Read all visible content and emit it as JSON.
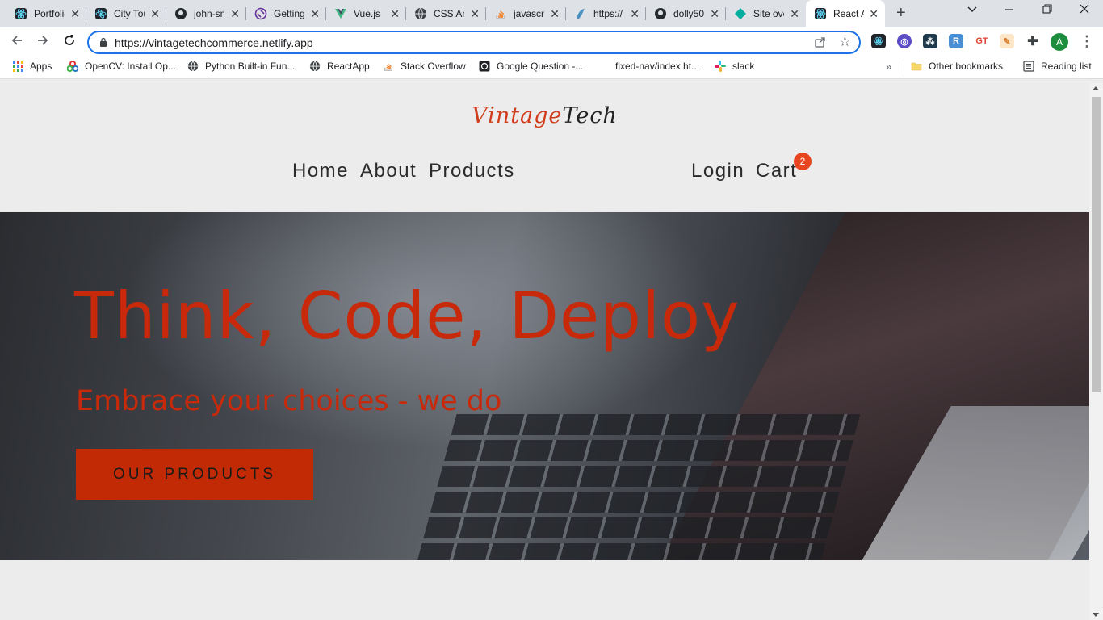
{
  "browser": {
    "tabs": [
      {
        "title": "Portfolio",
        "icon": "react-icon",
        "color": "#61dafb"
      },
      {
        "title": "City Tours",
        "icon": "react-icon",
        "color": "#61dafb"
      },
      {
        "title": "john-smilga",
        "icon": "github-icon",
        "color": "#24292e"
      },
      {
        "title": "Getting Started",
        "icon": "gatsby-icon",
        "color": "#663399"
      },
      {
        "title": "Vue.js",
        "icon": "vue-icon",
        "color": "#41b883"
      },
      {
        "title": "CSS Animations",
        "icon": "globe-icon",
        "color": "#202124"
      },
      {
        "title": "javascript",
        "icon": "stackoverflow-icon",
        "color": "#f48024"
      },
      {
        "title": "https://",
        "icon": "doc-icon",
        "color": "#4a90c2"
      },
      {
        "title": "dolly50",
        "icon": "github-icon",
        "color": "#24292e"
      },
      {
        "title": "Site overview",
        "icon": "netlify-icon",
        "color": "#00ad9f"
      },
      {
        "title": "React App",
        "icon": "react-icon",
        "color": "#61dafb"
      }
    ],
    "url": "https://vintagetechcommerce.netlify.app",
    "profile_initial": "A",
    "bookmarks": [
      {
        "label": "Apps",
        "icon": "apps-grid-icon"
      },
      {
        "label": "OpenCV: Install Op...",
        "icon": "opencv-icon"
      },
      {
        "label": "Python Built-in Fun...",
        "icon": "globe-icon"
      },
      {
        "label": "ReactApp",
        "icon": "globe-icon"
      },
      {
        "label": "Stack Overflow",
        "icon": "stackoverflow-icon"
      },
      {
        "label": "Google Question -...",
        "icon": "camera-icon"
      },
      {
        "label": "fixed-nav/index.ht...",
        "icon": "blank-icon"
      },
      {
        "label": "slack",
        "icon": "slack-icon"
      }
    ],
    "other_bookmarks": "Other bookmarks",
    "reading_list": "Reading list"
  },
  "site": {
    "logo_part1": "Vintage",
    "logo_part2": "Tech",
    "nav": {
      "home": "Home",
      "about": "About",
      "products": "Products",
      "login": "Login",
      "cart": "Cart",
      "cart_count": "2"
    },
    "hero": {
      "title": "Think, Code, Deploy",
      "subtitle": "Embrace your choices - we do",
      "button": "OUR PRODUCTS"
    }
  },
  "colors": {
    "accent": "#c8290a",
    "badge": "#e8451e",
    "button_bg": "#c22a05"
  }
}
